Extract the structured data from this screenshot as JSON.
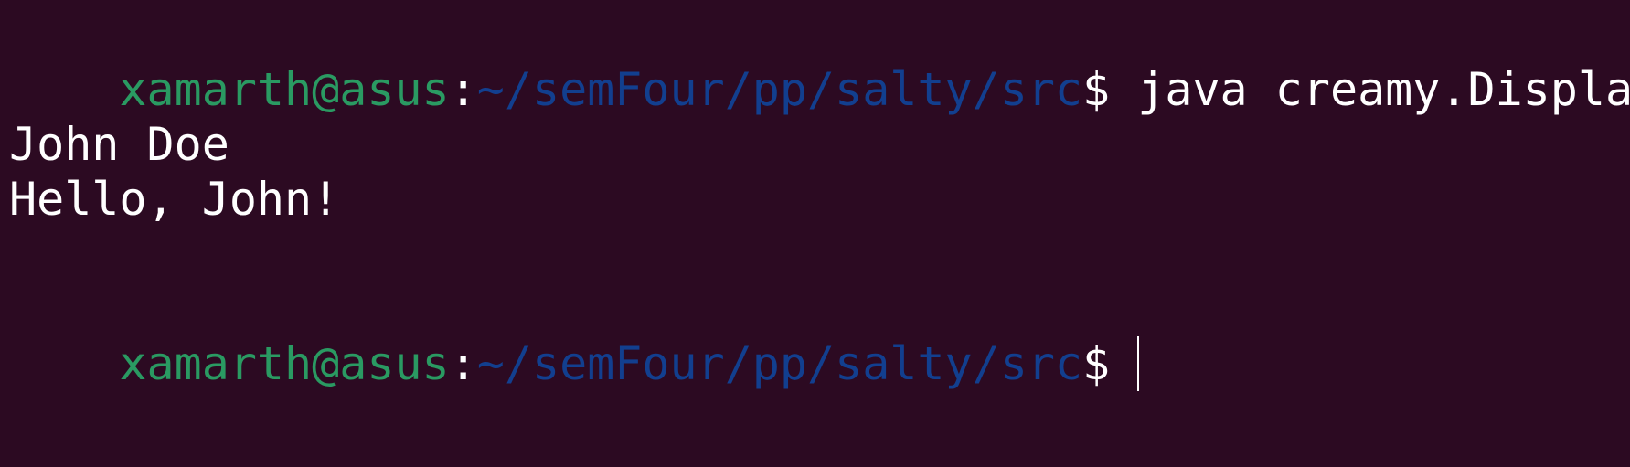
{
  "session1": {
    "user_host": "xamarth@asus",
    "colon": ":",
    "path": "~/semFour/pp/salty/src",
    "dollar": "$",
    "command": " java creamy.Display"
  },
  "output": {
    "line1": "John Doe",
    "line2": "Hello, John!"
  },
  "session2": {
    "user_host": "xamarth@asus",
    "colon": ":",
    "path": "~/semFour/pp/salty/src",
    "dollar": "$"
  },
  "colors": {
    "background": "#2c0a22",
    "user_host": "#2a9a62",
    "path": "#123f8f",
    "text": "#ffffff"
  }
}
